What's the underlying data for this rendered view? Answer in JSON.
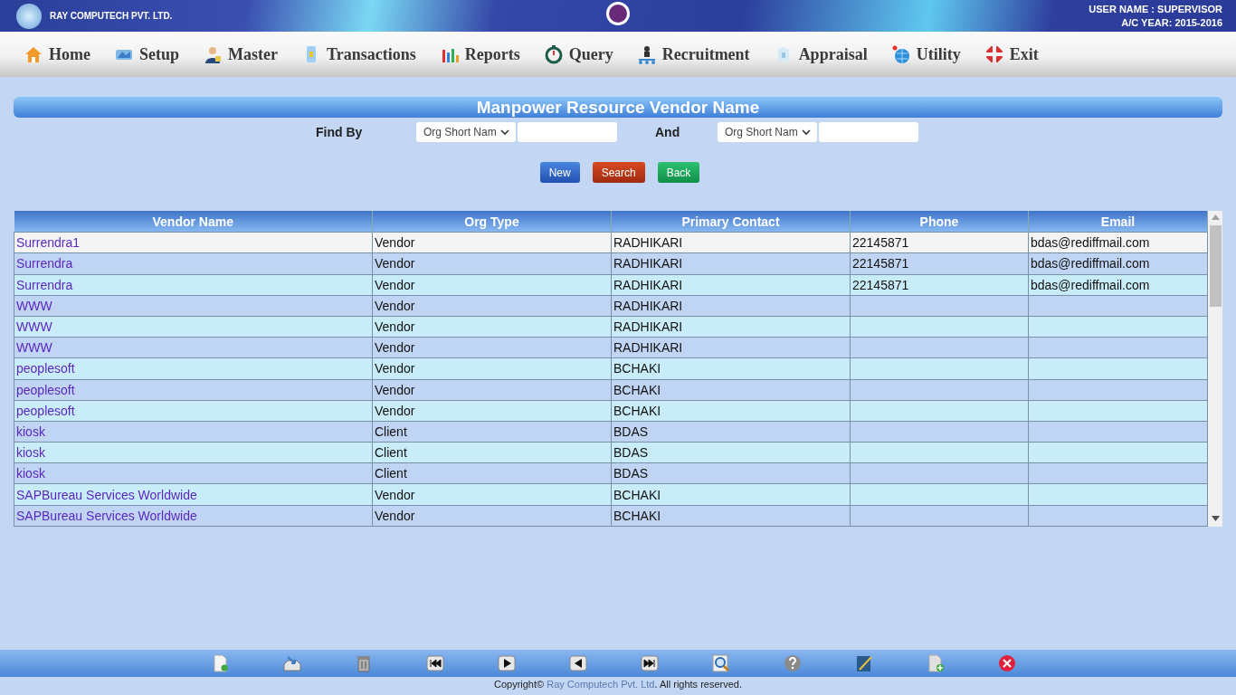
{
  "header": {
    "company": "RAY COMPUTECH PVT. LTD.",
    "user": "USER NAME : SUPERVISOR",
    "year": "A/C YEAR: 2015-2016"
  },
  "menu": [
    "Home",
    "Setup",
    "Master",
    "Transactions",
    "Reports",
    "Query",
    "Recruitment",
    "Appraisal",
    "Utility",
    "Exit"
  ],
  "page_title": "Manpower Resource Vendor Name",
  "find": {
    "label": "Find By",
    "select_1": "Org Short Nam",
    "and_label": "And",
    "select_2": "Org Short Nam"
  },
  "buttons": [
    {
      "label": "New",
      "kind": "blue"
    },
    {
      "label": "Search",
      "kind": "red"
    },
    {
      "label": "Back",
      "kind": "green"
    }
  ],
  "table": {
    "columns": [
      "Vendor Name",
      "Org Type",
      "Primary Contact",
      "Phone",
      "Email"
    ],
    "rows": [
      {
        "cells": [
          "Surrendra1",
          "Vendor",
          "RADHIKARI",
          "22145871",
          "bdas@rediffmail.com"
        ],
        "selected": true
      },
      {
        "cells": [
          "Surrendra",
          "Vendor",
          "RADHIKARI",
          "22145871",
          "bdas@rediffmail.com"
        ],
        "selected": false
      },
      {
        "cells": [
          "Surrendra",
          "Vendor",
          "RADHIKARI",
          "22145871",
          "bdas@rediffmail.com"
        ],
        "selected": false
      },
      {
        "cells": [
          "WWW",
          "Vendor",
          "RADHIKARI",
          "",
          ""
        ],
        "selected": false
      },
      {
        "cells": [
          "WWW",
          "Vendor",
          "RADHIKARI",
          "",
          ""
        ],
        "selected": false
      },
      {
        "cells": [
          "WWW",
          "Vendor",
          "RADHIKARI",
          "",
          ""
        ],
        "selected": false
      },
      {
        "cells": [
          "peoplesoft",
          "Vendor",
          "BCHAKI",
          "",
          ""
        ],
        "selected": false
      },
      {
        "cells": [
          "peoplesoft",
          "Vendor",
          "BCHAKI",
          "",
          ""
        ],
        "selected": false
      },
      {
        "cells": [
          "peoplesoft",
          "Vendor",
          "BCHAKI",
          "",
          ""
        ],
        "selected": false
      },
      {
        "cells": [
          "kiosk",
          "Client",
          "BDAS",
          "",
          ""
        ],
        "selected": false
      },
      {
        "cells": [
          "kiosk",
          "Client",
          "BDAS",
          "",
          ""
        ],
        "selected": false
      },
      {
        "cells": [
          "kiosk",
          "Client",
          "BDAS",
          "",
          ""
        ],
        "selected": false
      },
      {
        "cells": [
          "SAPBureau Services Worldwide",
          "Vendor",
          "BCHAKI",
          "",
          ""
        ],
        "selected": false
      },
      {
        "cells": [
          "SAPBureau Services Worldwide",
          "Vendor",
          "BCHAKI",
          "",
          ""
        ],
        "selected": false
      }
    ]
  },
  "footer": {
    "prefix": "Copyright© ",
    "link": "Ray Computech Pvt. Ltd",
    "suffix": ". All rights reserved."
  }
}
